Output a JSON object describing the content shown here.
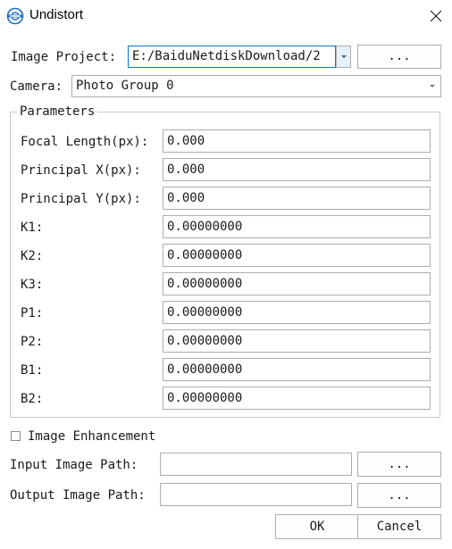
{
  "window": {
    "title": "Undistort",
    "icon": "app-logo-icon",
    "close_icon": "close-icon"
  },
  "image_project": {
    "label": "Image Project:",
    "value": "E:/BaiduNetdiskDownload/2",
    "browse_label": "..."
  },
  "camera": {
    "label": "Camera:",
    "value": "Photo Group 0"
  },
  "parameters": {
    "title": "Parameters",
    "fields": [
      {
        "label": "Focal Length(px):",
        "value": "0.000"
      },
      {
        "label": "Principal X(px):",
        "value": "0.000"
      },
      {
        "label": "Principal Y(px):",
        "value": "0.000"
      },
      {
        "label": "K1:",
        "value": "0.00000000"
      },
      {
        "label": "K2:",
        "value": "0.00000000"
      },
      {
        "label": "K3:",
        "value": "0.00000000"
      },
      {
        "label": "P1:",
        "value": "0.00000000"
      },
      {
        "label": "P2:",
        "value": "0.00000000"
      },
      {
        "label": "B1:",
        "value": "0.00000000"
      },
      {
        "label": "B2:",
        "value": "0.00000000"
      }
    ]
  },
  "image_enhancement": {
    "label": "Image Enhancement",
    "checked": false
  },
  "input_path": {
    "label": "Input Image Path:",
    "value": "",
    "browse_label": "..."
  },
  "output_path": {
    "label": "Output Image Path:",
    "value": "",
    "browse_label": "..."
  },
  "actions": {
    "ok_label": "OK",
    "cancel_label": "Cancel"
  },
  "colors": {
    "focus_border": "#0b77d8",
    "border": "#adadad",
    "group_border": "#c9c9c9",
    "dropdown_button_bg": "#e5f1fb"
  }
}
